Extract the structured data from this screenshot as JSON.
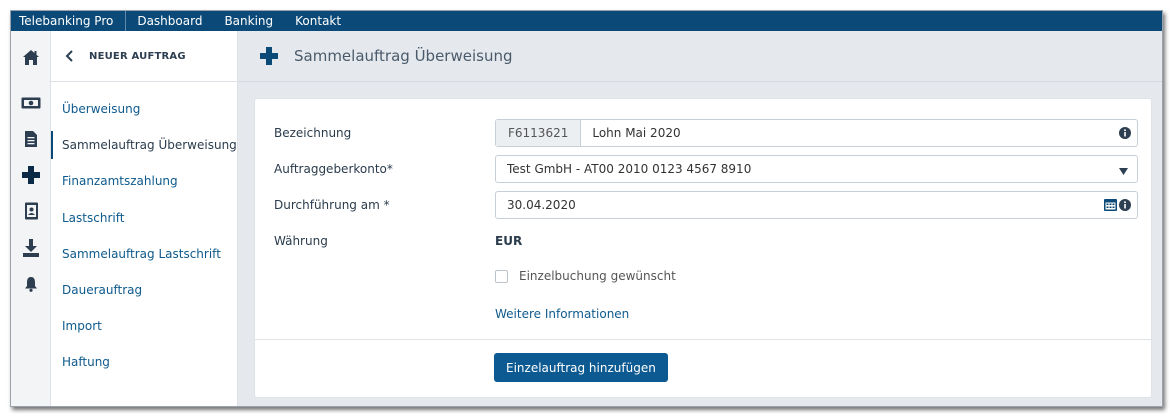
{
  "topbar": {
    "brand": "Telebanking Pro",
    "nav": [
      {
        "label": "Dashboard"
      },
      {
        "label": "Banking"
      },
      {
        "label": "Kontakt"
      }
    ]
  },
  "rail": {
    "icons": [
      "home-icon",
      "banknote-icon",
      "document-icon",
      "plus-icon",
      "address-book-icon",
      "download-icon",
      "bell-icon"
    ]
  },
  "menu": {
    "back_title": "NEUER AUFTRAG",
    "items": [
      {
        "label": "Überweisung"
      },
      {
        "label": "Sammelauftrag Überweisung",
        "active": true
      },
      {
        "label": "Finanzamtszahlung"
      },
      {
        "label": "Lastschrift"
      },
      {
        "label": "Sammelauftrag Lastschrift"
      },
      {
        "label": "Dauerauftrag"
      },
      {
        "label": "Import"
      },
      {
        "label": "Haftung"
      }
    ]
  },
  "main": {
    "title": "Sammelauftrag Überweisung",
    "form": {
      "bezeichnung_label": "Bezeichnung",
      "bezeichnung_prefix": "F6113621",
      "bezeichnung_value": "Lohn Mai 2020",
      "konto_label": "Auftraggeberkonto",
      "konto_value": "Test GmbH - AT00 2010 0123 4567 8910",
      "datum_label": "Durchführung am",
      "datum_value": "30.04.2020",
      "waehrung_label": "Währung",
      "waehrung_value": "EUR",
      "einzelbuchung_label": "Einzelbuchung gewünscht",
      "weitere_link": "Weitere Informationen",
      "add_button": "Einzelauftrag hinzufügen",
      "required_marker": "*"
    }
  },
  "colors": {
    "topbar": "#0b4a78",
    "accent": "#0d5a92",
    "link": "#0e5a8d",
    "background": "#e5e9ee"
  }
}
